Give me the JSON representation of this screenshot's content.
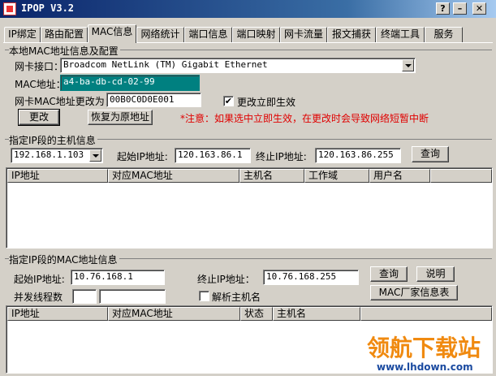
{
  "window": {
    "title": "IPOP V3.2",
    "help": "?",
    "minimize": "–",
    "close": "✕"
  },
  "tabs": [
    "IP绑定",
    "路由配置",
    "MAC信息",
    "网络统计",
    "端口信息",
    "端口映射",
    "网卡流量",
    "报文捕获",
    "终端工具",
    "服务"
  ],
  "local_mac": {
    "group_title": "本地MAC地址信息及配置",
    "nic_label": "网卡接口：",
    "nic_value": "Broadcom NetLink (TM) Gigabit Ethernet",
    "mac_label": "MAC地址：",
    "mac_value": "a4-ba-db-cd-02-99",
    "change_label": "网卡MAC地址更改为：",
    "change_value": "00B0C0D0E001",
    "apply_now_label": "更改立即生效",
    "apply_now_checked": "✔",
    "change_button": "更改",
    "restore_button": "恢复为原地址",
    "warning": "*注意：如果选中立即生效，在更改时会导致网络短暂中断"
  },
  "host_info": {
    "group_title": "指定IP段的主机信息",
    "ip_select": "192.168.1.103",
    "start_label": "起始IP地址:",
    "start_value": "120.163.86.1",
    "end_label": "终止IP地址:",
    "end_value": "120.163.86.255",
    "query_button": "查询",
    "columns": [
      "IP地址",
      "对应MAC地址",
      "主机名",
      "工作域",
      "用户名"
    ]
  },
  "mac_info": {
    "group_title": "指定IP段的MAC地址信息",
    "start_label": "起始IP地址:",
    "start_value": "10.76.168.1",
    "end_label": "终止IP地址：",
    "end_value": "10.76.168.255",
    "query_button": "查询",
    "help_button": "说明",
    "threads_label": "并发线程数",
    "resolve_label": "解析主机名",
    "vendor_button": "MAC厂家信息表",
    "columns": [
      "IP地址",
      "对应MAC地址",
      "状态",
      "主机名"
    ]
  },
  "watermark": {
    "logo_text": "领航下载站",
    "url": "www.lhdown.com"
  }
}
